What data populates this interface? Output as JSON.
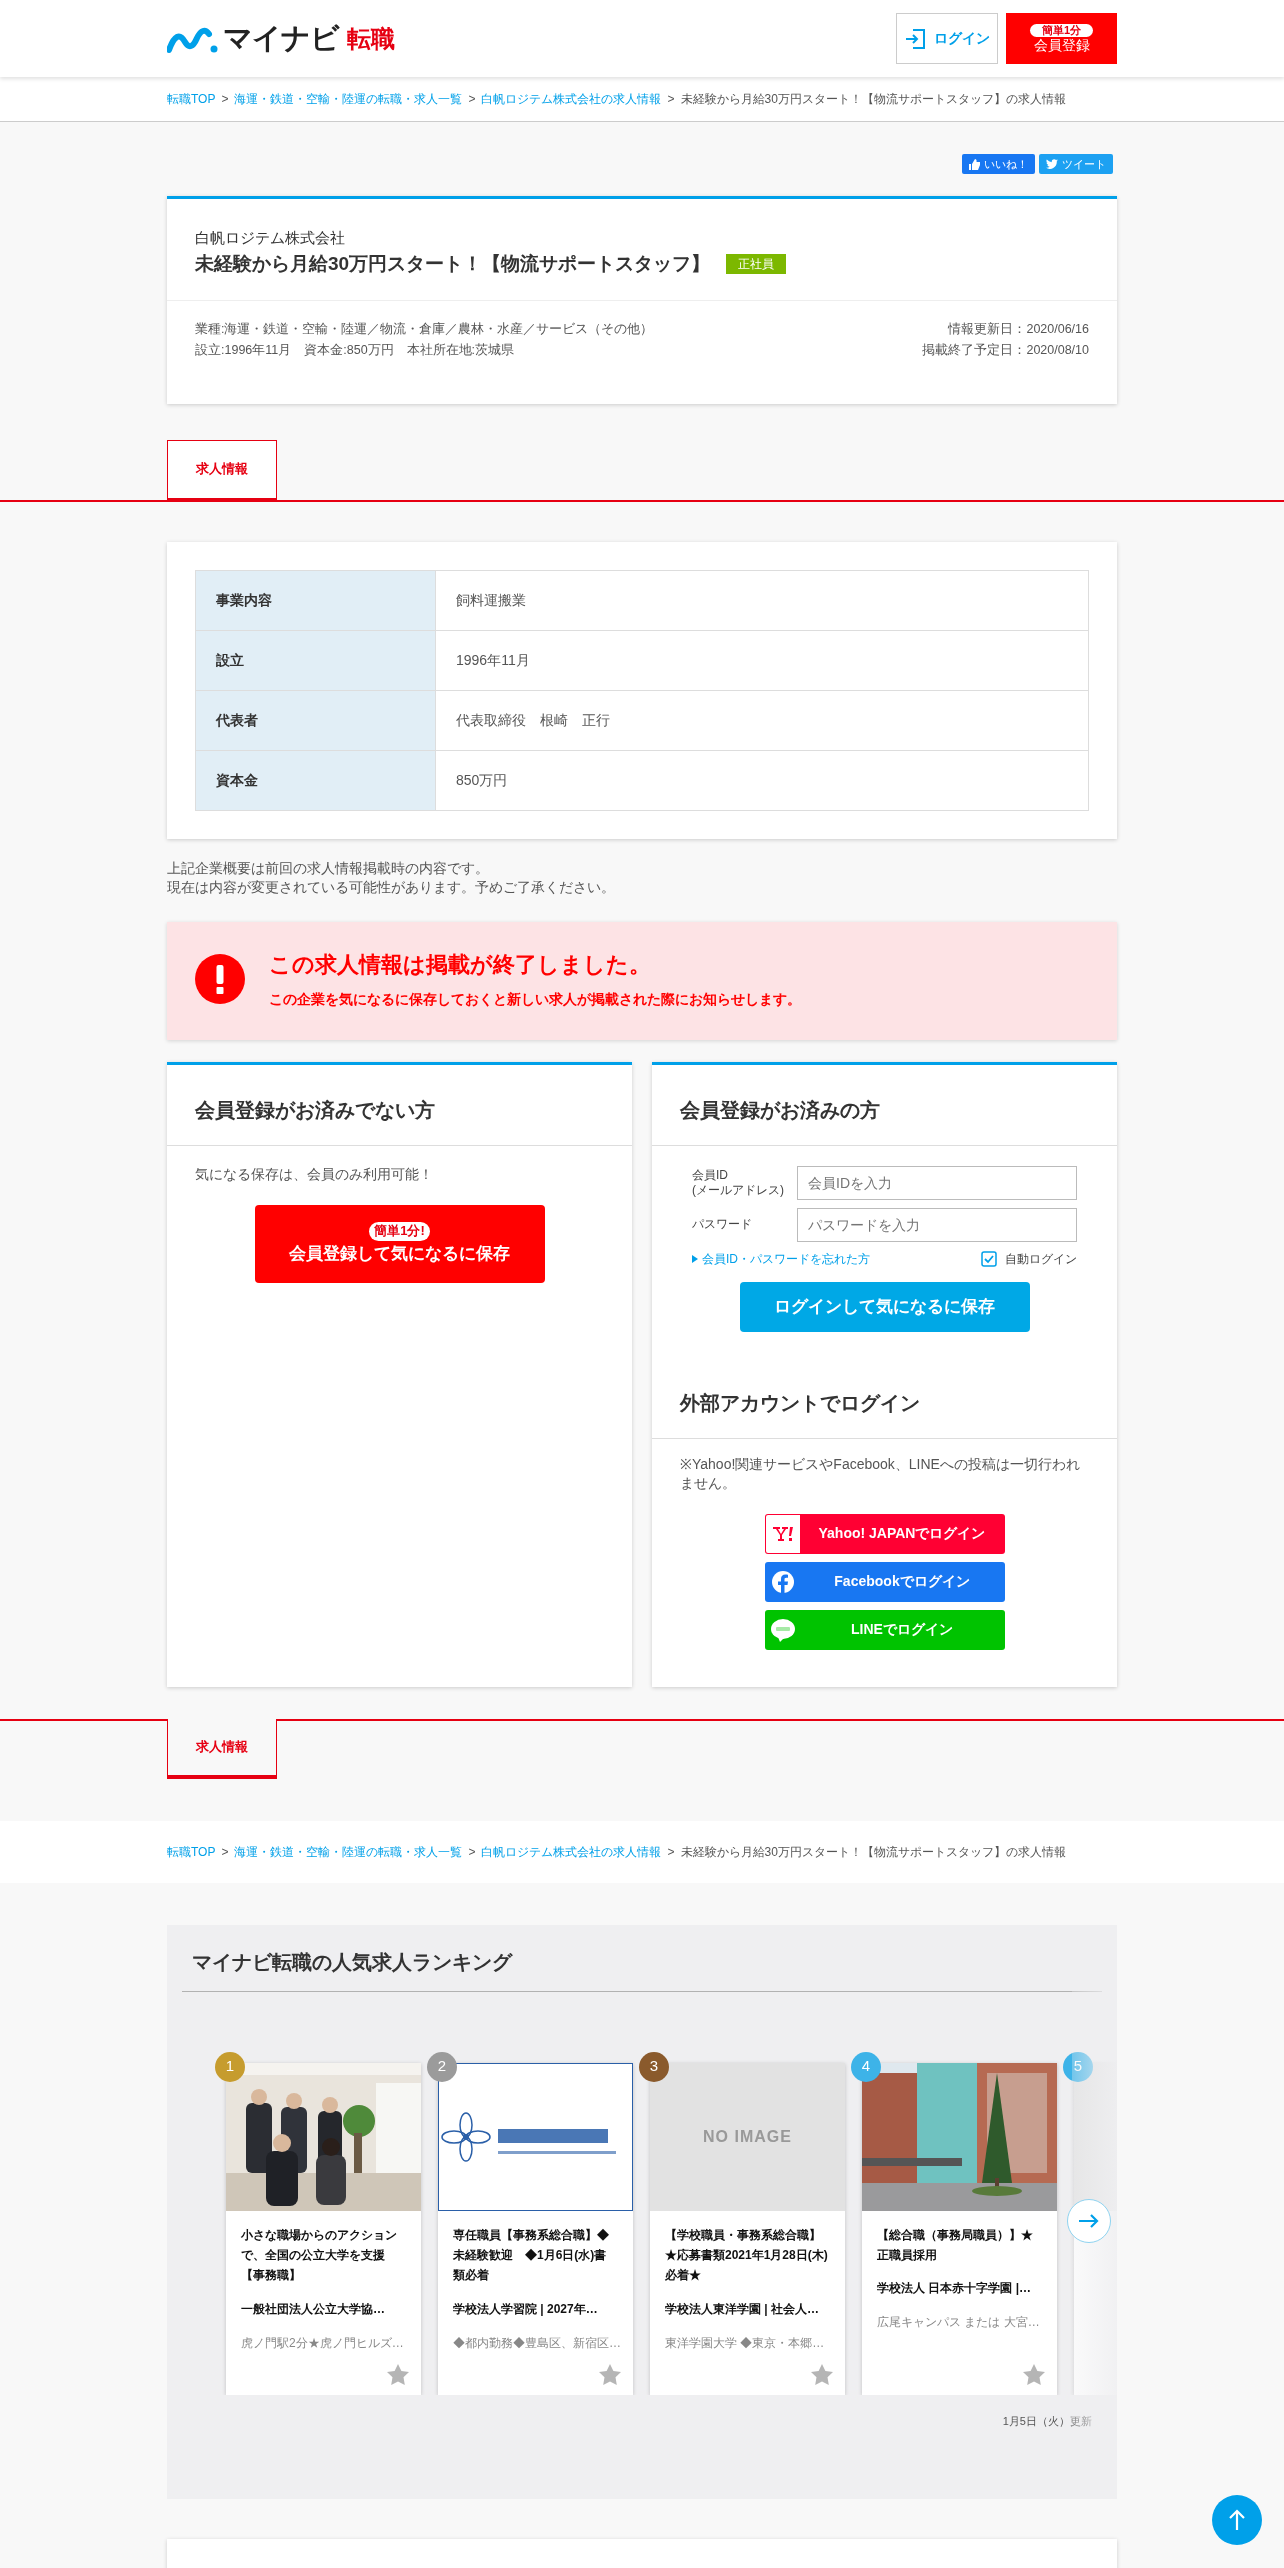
{
  "header": {
    "logo_text": "マイナビ",
    "logo_accent": "転職",
    "login": "ログイン",
    "register_badge": "簡単1分",
    "register": "会員登録"
  },
  "breadcrumb": {
    "separator": ">",
    "items": [
      {
        "label": "転職TOP",
        "current": false
      },
      {
        "label": "海運・鉄道・空輸・陸運の転職・求人一覧",
        "current": false
      },
      {
        "label": "白帆ロジテム株式会社の求人情報",
        "current": false
      },
      {
        "label": "未経験から月給30万円スタート！【物流サポートスタッフ】の求人情報",
        "current": true
      }
    ]
  },
  "share": [
    {
      "kind": "facebook",
      "label": "いいね！"
    },
    {
      "kind": "twitter",
      "label": "ツイート"
    }
  ],
  "job": {
    "company": "白帆ロジテム株式会社",
    "title": "未経験から月給30万円スタート！【物流サポートスタッフ】",
    "tag": "正社員",
    "meta_left": [
      "業種:海運・鉄道・空輸・陸運／物流・倉庫／農林・水産／サービス（その他）",
      "設立:1996年11月　資本金:850万円　本社所在地:茨城県"
    ],
    "meta_right": [
      "情報更新日：2020/06/16",
      "掲載終了予定日：2020/08/10"
    ]
  },
  "tabs": [
    {
      "label": "求人情報",
      "selected": true
    }
  ],
  "company_table": [
    {
      "label": "事業内容",
      "value": "飼料運搬業"
    },
    {
      "label": "設立",
      "value": "1996年11月"
    },
    {
      "label": "代表者",
      "value": "代表取締役　根崎　正行"
    },
    {
      "label": "資本金",
      "value": "850万円"
    }
  ],
  "note": [
    "上記企業概要は前回の求人情報掲載時の内容です。",
    "現在は内容が変更されている可能性があります。予めご了承ください。"
  ],
  "alert": {
    "title": "この求人情報は掲載が終了しました。",
    "message": "この企業を気になるに保存しておくと新しい求人が掲載された際にお知らせします。"
  },
  "guest_panel": {
    "title": "会員登録がお済みでない方",
    "text": "気になる保存は、会員のみ利用可能！",
    "button_badge": "簡単1分!",
    "button": "会員登録して気になるに保存"
  },
  "member_panel": {
    "title": "会員登録がお済みの方",
    "fields": [
      {
        "label": "会員ID",
        "sublabel": "(メールアドレス)",
        "placeholder": "会員IDを入力"
      },
      {
        "label": "パスワード",
        "placeholder": "パスワードを入力"
      }
    ],
    "forgot_link": "会員ID・パスワードを忘れた方",
    "auto_login": {
      "label": "自動ログイン",
      "checked": true
    },
    "login_button": "ログインして気になるに保存",
    "external_title": "外部アカウントでログイン",
    "external_note": "※Yahoo!関連サービスやFacebook、LINEへの投稿は一切行われません。",
    "external_buttons": [
      {
        "kind": "yahoo",
        "label": "Yahoo! JAPANでログイン"
      },
      {
        "kind": "facebook",
        "label": "Facebookでログイン"
      },
      {
        "kind": "line",
        "label": "LINEでログイン"
      }
    ]
  },
  "tabs_bottom": [
    {
      "label": "求人情報",
      "selected": true
    }
  ],
  "breadcrumb_bottom": {
    "separator": ">",
    "items": [
      {
        "label": "転職TOP",
        "current": false
      },
      {
        "label": "海運・鉄道・空輸・陸運の転職・求人一覧",
        "current": false
      },
      {
        "label": "白帆ロジテム株式会社の求人情報",
        "current": false
      },
      {
        "label": "未経験から月給30万円スタート！【物流サポートスタッフ】の求人情報",
        "current": true
      }
    ]
  },
  "ranking": {
    "title": "マイナビ転職の人気求人ランキング",
    "updated": "1月5日（火）更新",
    "cards": [
      {
        "rank": "1",
        "color": "#c69c2e",
        "kind": "picture",
        "title": "小さな職場からのアクションで、全国の公立大学を支援【事務職】",
        "company": "一般社団法人公立大学協…",
        "location": "虎ノ門駅2分★虎ノ門ヒルズ…",
        "favorite": false
      },
      {
        "rank": "2",
        "color": "#9b9b9b",
        "kind": "picture",
        "title": "専任職員【事務系総合職】◆未経験歓迎　◆1月6日(水)書類必着",
        "company": "学校法人学習院 | 2027年…",
        "location": "◆都内勤務◆豊島区、新宿区…",
        "favorite": false
      },
      {
        "rank": "3",
        "color": "#8a5a2c",
        "kind": "no_image",
        "image_text": "NO IMAGE",
        "title": "【学校職員・事務系総合職】★応募書類2021年1月28日(木)必着★",
        "company": "学校法人東洋学園 | 社会人…",
        "location": "東洋学園大学 ◆東京・本郷…",
        "favorite": false
      },
      {
        "rank": "4",
        "color": "#3db3e8",
        "kind": "picture",
        "title": "【総合職（事務局職員）】★正職員採用",
        "company": "学校法人 日本赤十字学園 |…",
        "location": "広尾キャンパス または 大宮…",
        "favorite": false
      },
      {
        "rank": "5",
        "color": "#3db3e8",
        "kind": "blank"
      }
    ]
  }
}
